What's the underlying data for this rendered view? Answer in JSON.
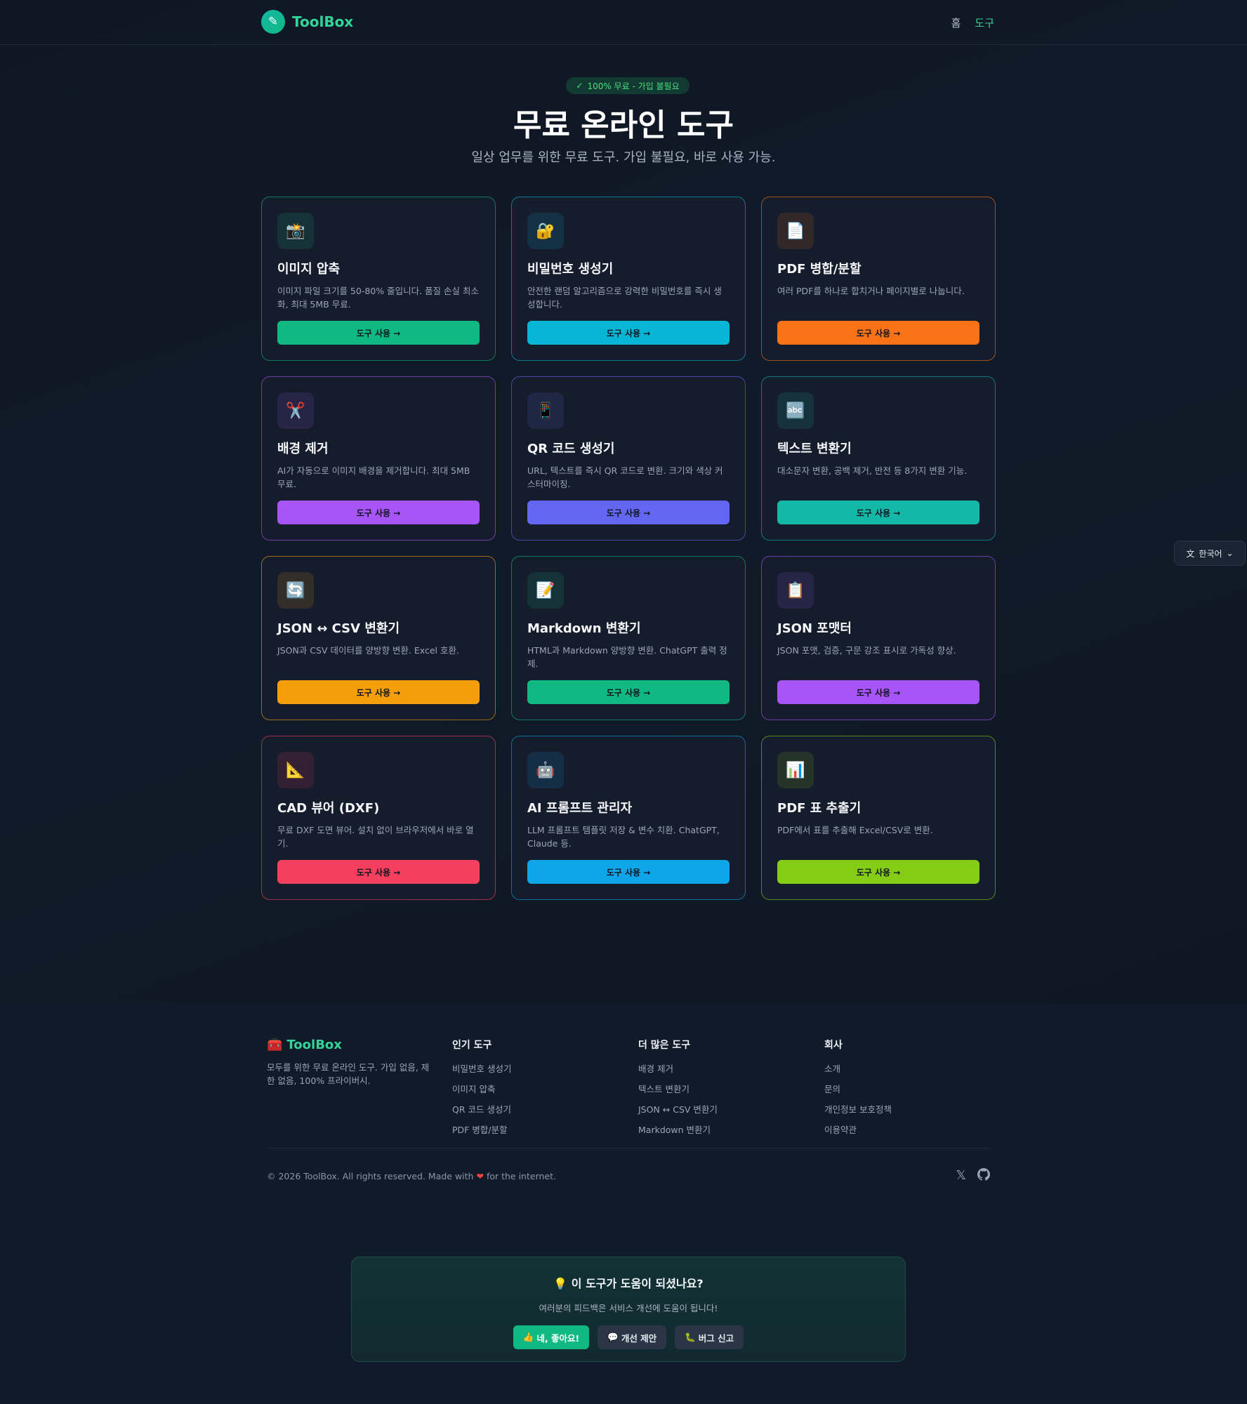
{
  "header": {
    "logo_text": "ToolBox",
    "nav": {
      "home": "홈",
      "tools": "도구"
    }
  },
  "hero": {
    "badge": "100% 무료 - 가입 불필요",
    "title": "무료 온라인 도구",
    "subtitle": "일상 업무를 위한 무료 도구. 가입 불필요, 바로 사용 가능."
  },
  "tools": [
    {
      "icon": "📸",
      "title": "이미지 압축",
      "desc": "이미지 파일 크기를 50-80% 줄입니다. 품질 손실 최소화, 최대 5MB 무료.",
      "button": "도구 사용 →",
      "color": "#10b981"
    },
    {
      "icon": "🔐",
      "title": "비밀번호 생성기",
      "desc": "안전한 랜덤 알고리즘으로 강력한 비밀번호를 즉시 생성합니다.",
      "button": "도구 사용 →",
      "color": "#06b6d4"
    },
    {
      "icon": "📄",
      "title": "PDF 병합/분할",
      "desc": "여러 PDF를 하나로 합치거나 페이지별로 나눕니다.",
      "button": "도구 사용 →",
      "color": "#f97316"
    },
    {
      "icon": "✂️",
      "title": "배경 제거",
      "desc": "AI가 자동으로 이미지 배경을 제거합니다. 최대 5MB 무료.",
      "button": "도구 사용 →",
      "color": "#a855f7"
    },
    {
      "icon": "📱",
      "title": "QR 코드 생성기",
      "desc": "URL, 텍스트를 즉시 QR 코드로 변환. 크기와 색상 커스터마이징.",
      "button": "도구 사용 →",
      "color": "#6366f1"
    },
    {
      "icon": "🔤",
      "title": "텍스트 변환기",
      "desc": "대소문자 변환, 공백 제거, 반전 등 8가지 변환 기능.",
      "button": "도구 사용 →",
      "color": "#14b8a6"
    },
    {
      "icon": "🔄",
      "title": "JSON ↔ CSV 변환기",
      "desc": "JSON과 CSV 데이터를 양방향 변환. Excel 호환.",
      "button": "도구 사용 →",
      "color": "#f59e0b"
    },
    {
      "icon": "📝",
      "title": "Markdown 변환기",
      "desc": "HTML과 Markdown 양방향 변환. ChatGPT 출력 정제.",
      "button": "도구 사용 →",
      "color": "#10b981"
    },
    {
      "icon": "📋",
      "title": "JSON 포맷터",
      "desc": "JSON 포맷, 검증, 구문 강조 표시로 가독성 향상.",
      "button": "도구 사용 →",
      "color": "#a855f7"
    },
    {
      "icon": "📐",
      "title": "CAD 뷰어 (DXF)",
      "desc": "무료 DXF 도면 뷰어. 설치 없이 브라우저에서 바로 열기.",
      "button": "도구 사용 →",
      "color": "#f43f5e"
    },
    {
      "icon": "🤖",
      "title": "AI 프롬프트 관리자",
      "desc": "LLM 프롬프트 템플릿 저장 & 변수 치환. ChatGPT, Claude 등.",
      "button": "도구 사용 →",
      "color": "#0ea5e9"
    },
    {
      "icon": "📊",
      "title": "PDF 표 추출기",
      "desc": "PDF에서 표를 추출해 Excel/CSV로 변환.",
      "button": "도구 사용 →",
      "color": "#84cc16"
    }
  ],
  "lang": {
    "label": "한국어"
  },
  "footer": {
    "brand": "ToolBox",
    "brand_desc": "모두를 위한 무료 온라인 도구. 가입 없음, 제한 없음, 100% 프라이버시.",
    "col1": {
      "title": "인기 도구",
      "links": [
        "비밀번호 생성기",
        "이미지 압축",
        "QR 코드 생성기",
        "PDF 병합/분할"
      ]
    },
    "col2": {
      "title": "더 많은 도구",
      "links": [
        "배경 제거",
        "텍스트 변환기",
        "JSON ↔ CSV 변환기",
        "Markdown 변환기"
      ]
    },
    "col3": {
      "title": "회사",
      "links": [
        "소개",
        "문의",
        "개인정보 보호정책",
        "이용약관"
      ]
    },
    "copyright_pre": "© 2026 ToolBox. All rights reserved. Made with",
    "copyright_post": "for the internet."
  },
  "feedback": {
    "title": "이 도구가 도움이 되셨나요?",
    "subtitle": "여러분의 피드백은 서비스 개선에 도움이 됩니다!",
    "yes": "네, 좋아요!",
    "suggest": "개선 제안",
    "bug": "버그 신고"
  }
}
